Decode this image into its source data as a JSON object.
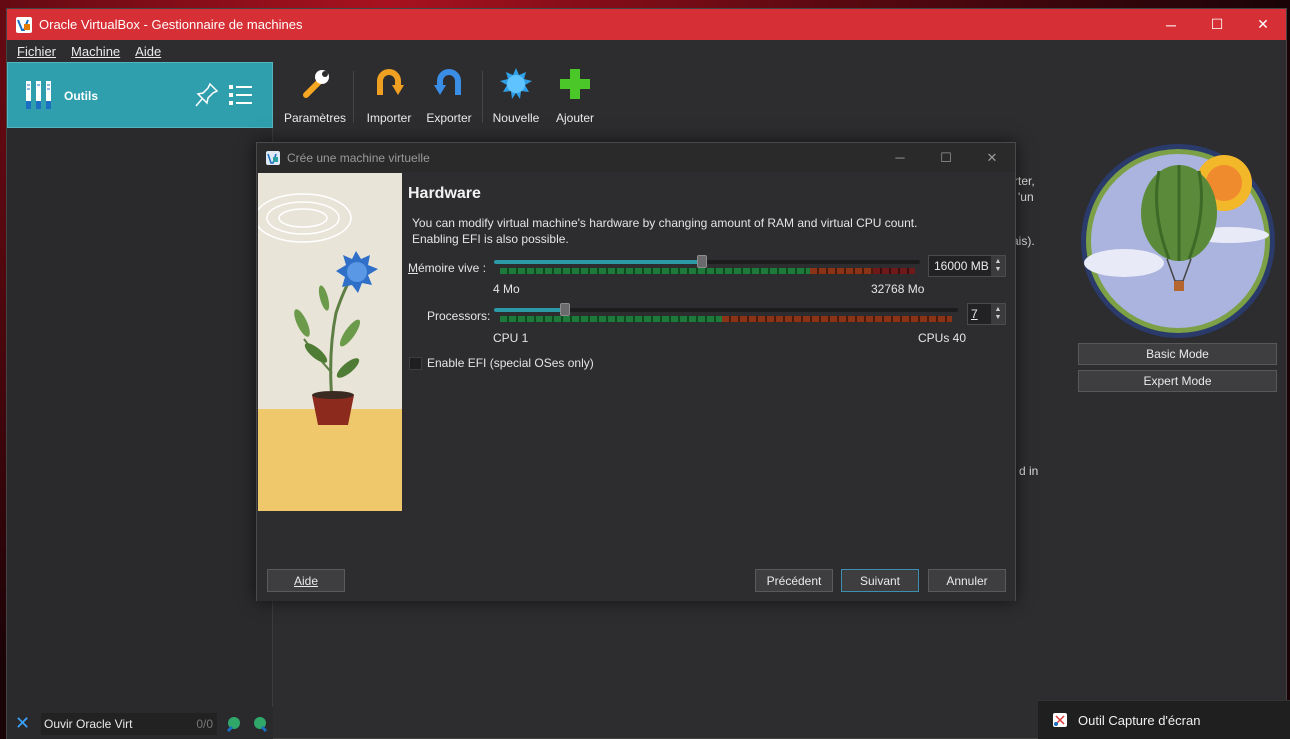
{
  "window": {
    "title": "Oracle VirtualBox - Gestionnaire de machines",
    "controls": {
      "minimize": "─",
      "maximize": "☐",
      "close": "✕"
    }
  },
  "menu": [
    {
      "label": "Fichier"
    },
    {
      "label": "Machine"
    },
    {
      "label": "Aide"
    }
  ],
  "sidebar": {
    "tools_label": "Outils",
    "search": {
      "value": "Ouvir Oracle Virt",
      "count": "0/0"
    }
  },
  "toolbar": {
    "settings": "Paramètres",
    "import": "Importer",
    "export": "Exporter",
    "new": "Nouvelle",
    "add": "Ajouter"
  },
  "background_fragments": {
    "line1": "rter,",
    "line2": "'un",
    "line3": "ais).",
    "line4": "d in"
  },
  "welcome": {
    "basic_mode": "Basic Mode",
    "expert_mode": "Expert Mode"
  },
  "dialog": {
    "title": "Crée une machine virtuelle",
    "controls": {
      "minimize": "─",
      "maximize": "☐",
      "close": "✕"
    },
    "heading": "Hardware",
    "description_line1": "You can modify virtual machine's hardware by changing amount of RAM and virtual CPU count.",
    "description_line2": "Enabling EFI is also possible.",
    "memory": {
      "label": "Mémoire vive :",
      "value": "16000 MB",
      "min_label": "4 Mo",
      "max_label": "32768 Mo",
      "min": 4,
      "max": 32768,
      "current": 16000
    },
    "processors": {
      "label": "Processors:",
      "value": "7",
      "min_label": "CPU 1",
      "max_label": "CPUs 40",
      "min": 1,
      "max": 40,
      "current": 7
    },
    "efi": {
      "label": "Enable EFI (special OSes only)",
      "checked": false
    },
    "buttons": {
      "help": "Aide",
      "back": "Précédent",
      "next": "Suivant",
      "cancel": "Annuler"
    }
  },
  "taskbar_notification": {
    "text": "Outil Capture d'écran"
  },
  "colors": {
    "titlebar": "#d62f35",
    "accent": "#2f9fae",
    "slider_fill": "#2b9aa6",
    "window_bg": "#2d2d2f"
  }
}
